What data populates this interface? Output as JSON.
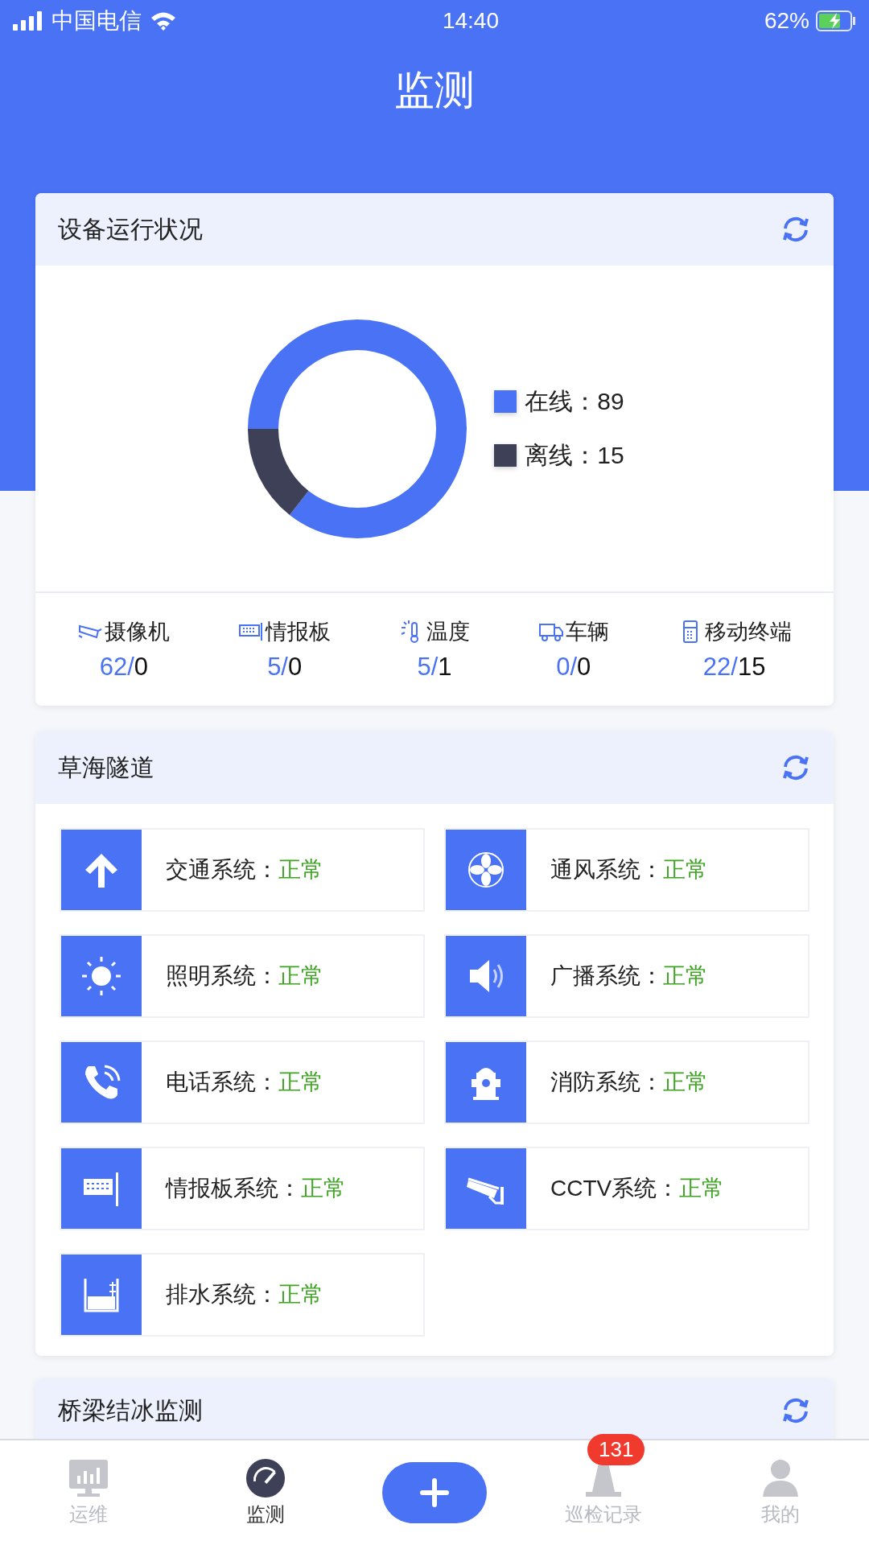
{
  "status_bar": {
    "carrier": "中国电信",
    "time": "14:40",
    "battery": "62%"
  },
  "title": "监测",
  "device_card": {
    "title": "设备运行状况",
    "legend": [
      {
        "separator": "：",
        "value": "89",
        "color": "#4a72f5"
      },
      {
        "separator": "：",
        "value": "15",
        "color": "#3d4057"
      }
    ],
    "chart_data": {
      "type": "donut",
      "categories": [
        "在线",
        "离线"
      ],
      "values": [
        85.6,
        14.4
      ],
      "legend": "right"
    },
    "stats": [
      {
        "kind": "camera",
        "label": "摄像机",
        "online": "62/",
        "offline": "0"
      },
      {
        "kind": "board",
        "label": "情报板",
        "online": "5/",
        "offline": "0"
      },
      {
        "kind": "thermometer",
        "label": "温度",
        "online": "5/",
        "offline": "1"
      },
      {
        "kind": "truck",
        "label": "车辆",
        "online": "0/",
        "offline": "0"
      },
      {
        "kind": "terminal",
        "label": "移动终端",
        "online": "22/",
        "offline": "15"
      }
    ]
  },
  "tunnel_card": {
    "title": "草海隧道",
    "systems": [
      {
        "kind": "arrow",
        "label": "交通系统：",
        "status": "正常"
      },
      {
        "kind": "fan",
        "label": "通风系统：",
        "status": "正常"
      },
      {
        "kind": "sun",
        "label": "照明系统：",
        "status": "正常"
      },
      {
        "kind": "speaker",
        "label": "广播系统：",
        "status": "正常"
      },
      {
        "kind": "phone",
        "label": "电话系统：",
        "status": "正常"
      },
      {
        "kind": "hydrant",
        "label": "消防系统：",
        "status": "正常"
      },
      {
        "kind": "board",
        "label": "情报板系统：",
        "status": "正常"
      },
      {
        "kind": "cctv",
        "label": "CCTV系统：",
        "status": "正常"
      },
      {
        "kind": "drain",
        "label": "排水系统：",
        "status": "正常"
      }
    ]
  },
  "bridge_card": {
    "title": "桥梁结冰监测"
  },
  "tab_bar": [
    {
      "kind": "chart",
      "label": "运维",
      "selected": false
    },
    {
      "kind": "gauge",
      "label": "监测",
      "selected": true
    },
    {
      "kind": "add"
    },
    {
      "kind": "cone",
      "label": "巡检记录",
      "selected": false,
      "badge": "131"
    },
    {
      "kind": "user",
      "label": "我的",
      "selected": false
    }
  ]
}
